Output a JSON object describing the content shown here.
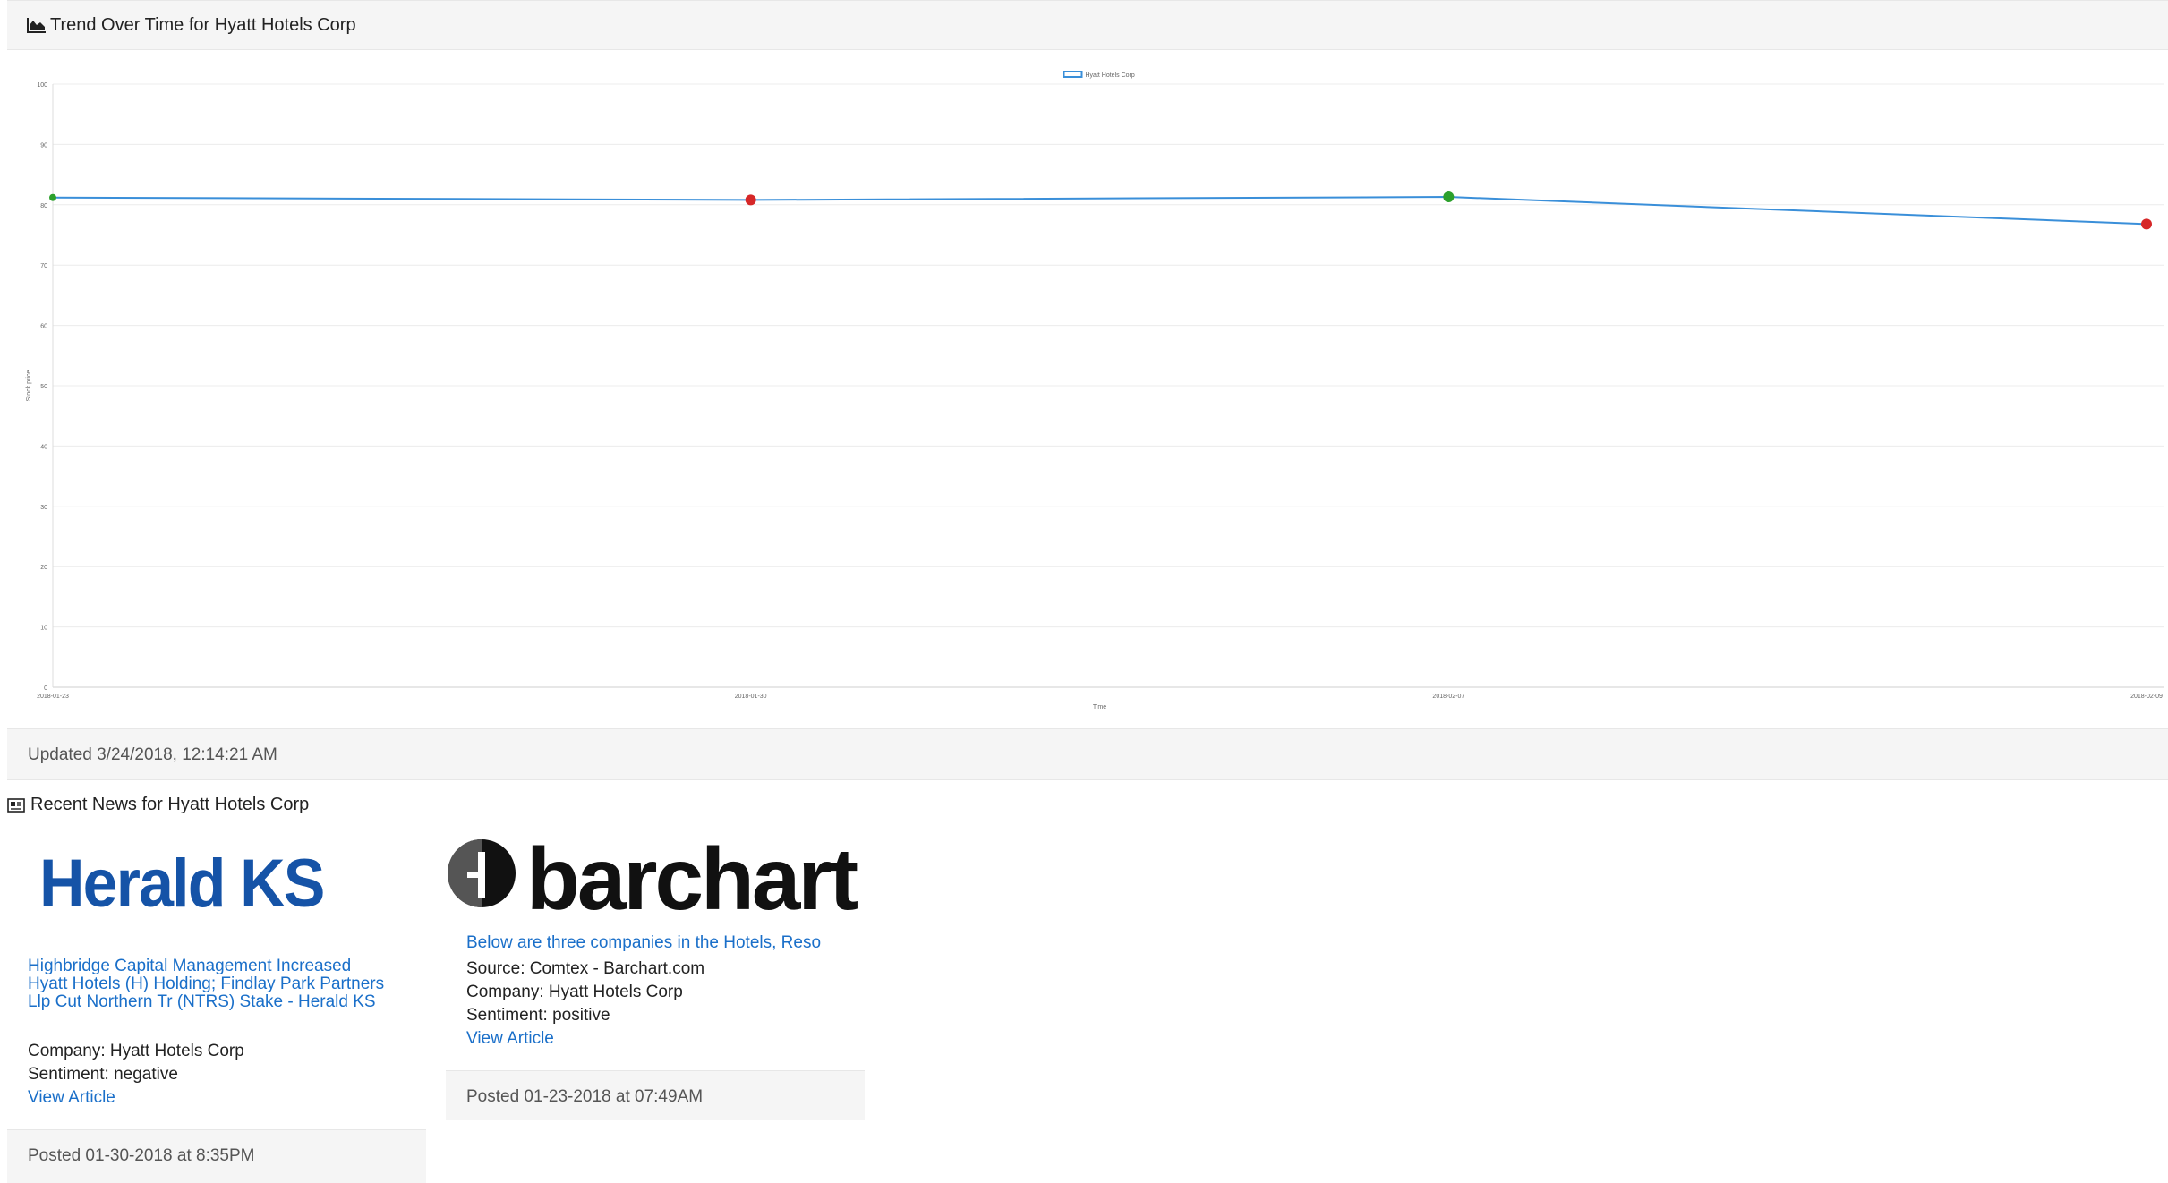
{
  "chart_panel": {
    "title": "Trend Over Time for Hyatt Hotels Corp",
    "icon": "area-chart-icon",
    "updated": "Updated 3/24/2018, 12:14:21 AM"
  },
  "chart_data": {
    "type": "line",
    "xlabel": "Time",
    "ylabel": "Stock price",
    "ylim": [
      0,
      100
    ],
    "y_ticks": [
      0,
      10,
      20,
      30,
      40,
      50,
      60,
      70,
      80,
      90,
      100
    ],
    "x": [
      "2018-01-23",
      "2018-01-30",
      "2018-02-07",
      "2018-02-09"
    ],
    "series": [
      {
        "name": "Hyatt Hotels Corp",
        "values": [
          81.2,
          80.8,
          81.3,
          76.8
        ],
        "point_sentiment": [
          "positive",
          "negative",
          "positive",
          "negative"
        ]
      }
    ],
    "legend": "top",
    "grid": true,
    "colors": {
      "line": "#3a8fd9",
      "positive": "#2ca02c",
      "negative": "#d62728"
    }
  },
  "news_panel": {
    "title": "Recent News for Hyatt Hotels Corp",
    "icon": "newspaper-icon",
    "articles": [
      {
        "logo_text": "Herald KS",
        "headline_lines": [
          "Highbridge Capital Management Increased",
          "Hyatt Hotels (H) Holding; Findlay Park Partners",
          "Llp Cut Northern Tr (NTRS) Stake - Herald KS"
        ],
        "company": "Company: Hyatt Hotels Corp",
        "sentiment": "Sentiment: negative",
        "view": "View Article",
        "posted": "Posted 01-30-2018 at 8:35PM"
      },
      {
        "logo_text": "barchart",
        "headline": "Below are three companies in the Hotels, Reso",
        "source": "Source: Comtex - Barchart.com",
        "company": "Company: Hyatt Hotels Corp",
        "sentiment": "Sentiment: positive",
        "view": "View Article",
        "posted": "Posted 01-23-2018 at 07:49AM"
      }
    ]
  }
}
